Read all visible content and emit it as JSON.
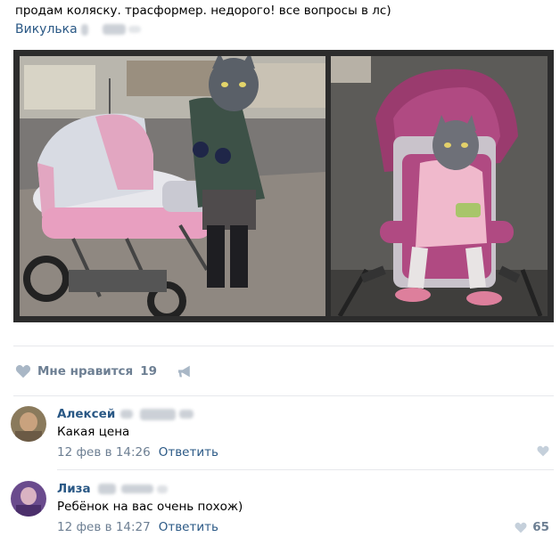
{
  "post": {
    "text": "продам коляску. трасформер. недорого! все вопросы в лс)",
    "author": "Викулька"
  },
  "photos": [
    {
      "name": "photo-left"
    },
    {
      "name": "photo-right"
    }
  ],
  "likes": {
    "label": "Мне нравится",
    "count": "19",
    "icon": "heart-icon",
    "share_icon": "megaphone-icon"
  },
  "comments": [
    {
      "name": "Алексей",
      "text": "Какая цена",
      "time": "12 фев в 14:26",
      "reply": "Ответить",
      "likes": ""
    },
    {
      "name": "Лиза",
      "text": "Ребёнок на вас очень похож)",
      "time": "12 фев в 14:27",
      "reply": "Ответить",
      "likes": "65"
    }
  ],
  "colors": {
    "link": "#2a5885",
    "muted": "#6d7f93",
    "divider": "#e7e8ec"
  }
}
